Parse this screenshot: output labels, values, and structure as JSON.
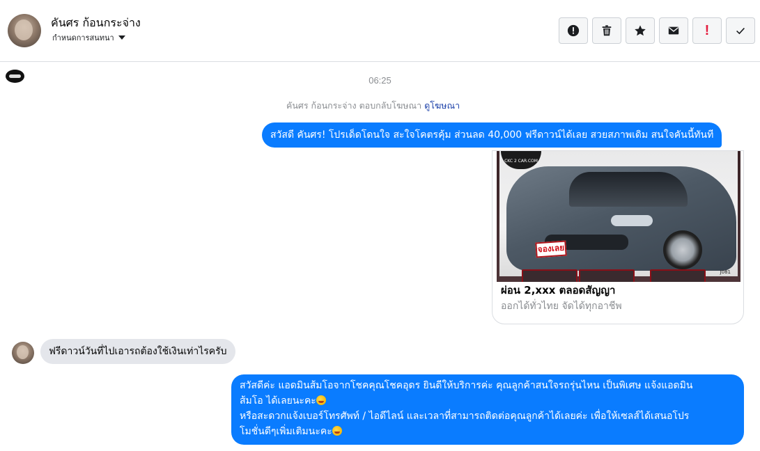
{
  "header": {
    "contact_name": "คันศร ก้อนกระจ่าง",
    "assign_label": "กำหนดการสนทนา",
    "actions": [
      {
        "name": "report-icon",
        "label": "!"
      },
      {
        "name": "trash-icon",
        "label": ""
      },
      {
        "name": "star-icon",
        "label": "★"
      },
      {
        "name": "envelope-icon",
        "label": ""
      },
      {
        "name": "exclamation-icon",
        "label": "!"
      },
      {
        "name": "check-icon",
        "label": "✓"
      }
    ]
  },
  "conversation": {
    "timestamp": "06:25",
    "ad_reply_text": "คันศร ก้อนกระจ่าง ตอบกลับโฆษณา",
    "ad_reply_link": "ดูโฆษณา",
    "messages": [
      {
        "direction": "out",
        "text": "สวัสดี คันศร! โปรเด็ดโดนใจ สะใจโคตรคุ้ม ส่วนลด 40,000 ฟรีดาวน์ได้เลย สวยสภาพเดิม สนใจคันนี้ทันที"
      },
      {
        "direction": "in",
        "text": "ฟรีดาวน์วันที่ไปเอารถต้องใช้เงินเท่าไรครับ"
      },
      {
        "direction": "out",
        "lines": [
          "สวัสดีค่ะ แอดมินส้มโอจากโชคคุณโชคอุดร ยินดีให้บริการค่ะ   คุณลูกค้าสนใจรถรุ่นไหน เป็นพิเศษ แจ้งแอดมิน",
          "ส้มโอ ได้เลยนะคะ",
          "หรือสะดวกแจ้งเบอร์โทรศัพท์ / ไอดีไลน์ และเวลาที่สามารถติดต่อคุณลูกค้าได้เลยค่ะ เพื่อให้เซลส์ได้เสนอโปร",
          "โมชั่นดีๆเพิ่มเติมนะคะ"
        ]
      }
    ],
    "ad_card": {
      "title": "ผ่อน 2,xxx ตลอดสัญญา",
      "subtitle": "ออกได้ทั่วไทย จัดได้ทุกอาชีพ",
      "image_badge": "CKC 2 CAR.COM",
      "image_sticker": "จองเลย",
      "image_code": "J081"
    }
  },
  "colors": {
    "outgoing_bubble": "#0a7cff",
    "incoming_bubble": "#e4e6eb",
    "link": "#1a3fa8",
    "muted": "#8a8d91"
  }
}
